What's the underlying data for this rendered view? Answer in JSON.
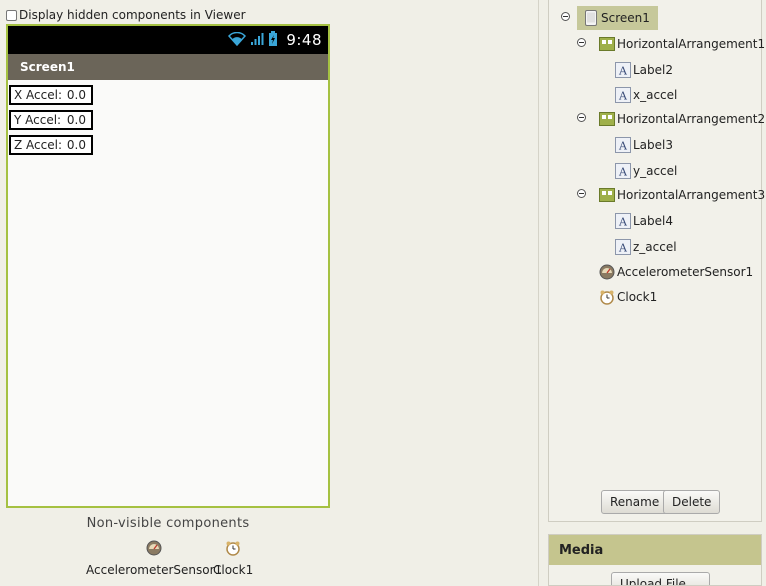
{
  "viewer": {
    "hidden_toggle_label": "Display hidden components in Viewer",
    "status_time": "9:48",
    "screen_title": "Screen1",
    "rows": [
      {
        "label": "X Accel:",
        "value": "0.0"
      },
      {
        "label": "Y Accel:",
        "value": "0.0"
      },
      {
        "label": "Z Accel:",
        "value": "0.0"
      }
    ],
    "nonvisible_title": "Non-visible components",
    "nonvisible": [
      {
        "name": "AccelerometerSensor1",
        "icon": "accelerometer-icon"
      },
      {
        "name": "Clock1",
        "icon": "clock-icon"
      }
    ]
  },
  "components": {
    "screen": "Screen1",
    "arrangements": [
      {
        "name": "HorizontalArrangement1",
        "children": [
          "Label2",
          "x_accel"
        ]
      },
      {
        "name": "HorizontalArrangement2",
        "children": [
          "Label3",
          "y_accel"
        ]
      },
      {
        "name": "HorizontalArrangement3",
        "children": [
          "Label4",
          "z_accel"
        ]
      }
    ],
    "sensors": [
      "AccelerometerSensor1",
      "Clock1"
    ],
    "rename_label": "Rename",
    "delete_label": "Delete"
  },
  "media": {
    "title": "Media",
    "upload_label": "Upload File ..."
  },
  "colors": {
    "accent_green": "#a5c142",
    "panel_header": "#c5c58e",
    "title_bar": "#6b6559"
  }
}
